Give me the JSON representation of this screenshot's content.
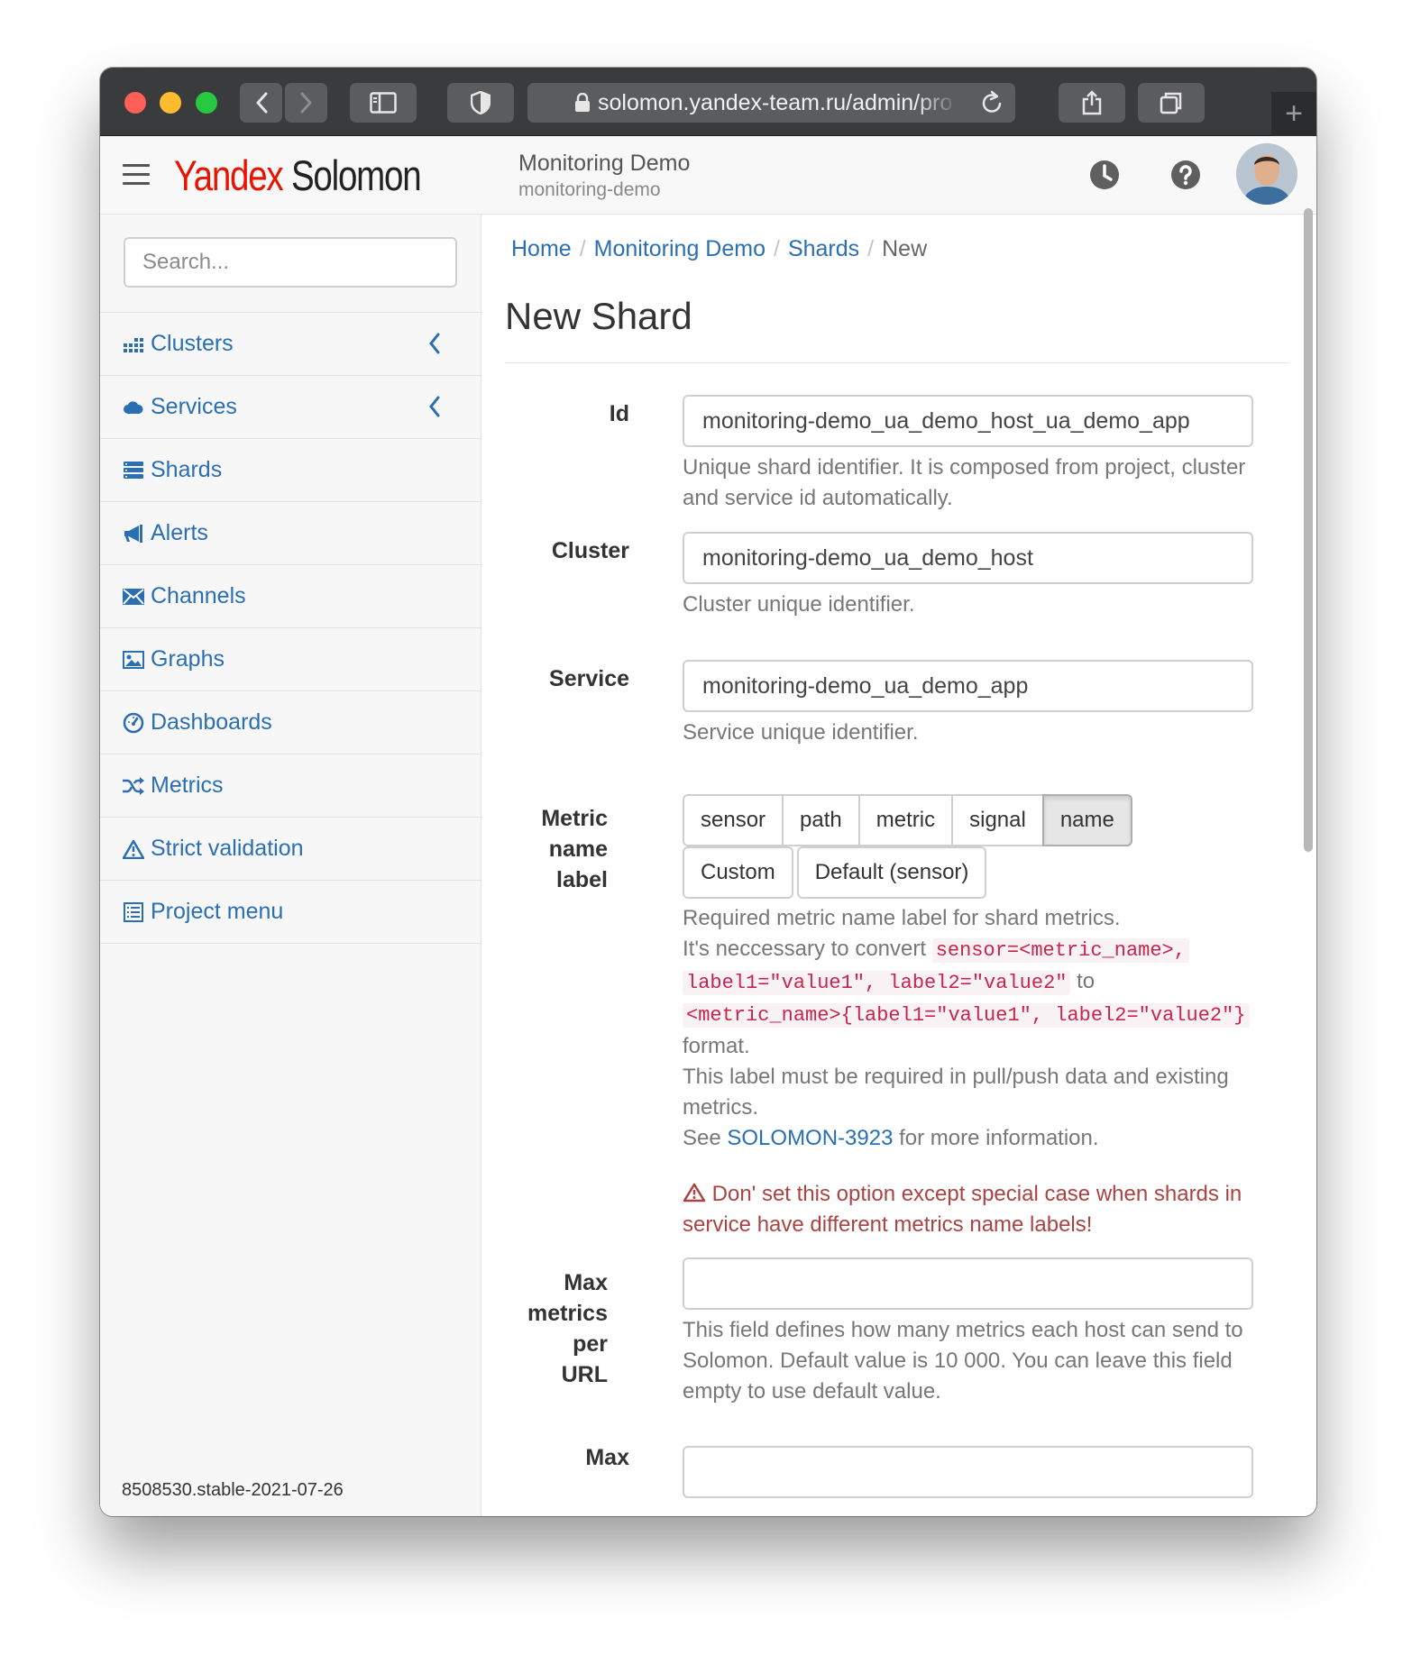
{
  "browser": {
    "url": "solomon.yandex-team.ru/admin/pro",
    "new_tab_symbol": "+"
  },
  "header": {
    "logo_yandex": "Yandex",
    "logo_solomon": "Solomon",
    "project_title": "Monitoring Demo",
    "project_id": "monitoring-demo"
  },
  "sidebar": {
    "search_placeholder": "Search...",
    "items": [
      {
        "label": "Clusters",
        "icon": "clusters-icon"
      },
      {
        "label": "Services",
        "icon": "cloud-icon"
      },
      {
        "label": "Shards",
        "icon": "shards-icon"
      },
      {
        "label": "Alerts",
        "icon": "megaphone-icon"
      },
      {
        "label": "Channels",
        "icon": "envelope-icon"
      },
      {
        "label": "Graphs",
        "icon": "picture-icon"
      },
      {
        "label": "Dashboards",
        "icon": "dashboard-icon"
      },
      {
        "label": "Metrics",
        "icon": "random-icon"
      },
      {
        "label": "Strict validation",
        "icon": "warning-icon"
      },
      {
        "label": "Project menu",
        "icon": "list-icon"
      }
    ],
    "version": "8508530.stable-2021-07-26"
  },
  "breadcrumb": {
    "home": "Home",
    "project": "Monitoring Demo",
    "shards": "Shards",
    "current": "New",
    "separator": "/"
  },
  "page_title": "New Shard",
  "form": {
    "id": {
      "label": "Id",
      "value": "monitoring-demo_ua_demo_host_ua_demo_app",
      "help": "Unique shard identifier. It is composed from project, cluster and service id automatically."
    },
    "cluster": {
      "label": "Cluster",
      "value": "monitoring-demo_ua_demo_host",
      "help": "Cluster unique identifier."
    },
    "service": {
      "label": "Service",
      "value": "monitoring-demo_ua_demo_app",
      "help": "Service unique identifier."
    },
    "metric_name_label": {
      "label_line1": "Metric",
      "label_line2": "name",
      "label_line3": "label",
      "options": [
        "sensor",
        "path",
        "metric",
        "signal",
        "name"
      ],
      "selected": "name",
      "extra_options": [
        "Custom",
        "Default (sensor)"
      ],
      "help_line1": "Required metric name label for shard metrics.",
      "help_convert_prefix": "It's neccessary to convert",
      "code1a": "sensor=<metric_name>,",
      "code1b": "label1=\"value1\", label2=\"value2\"",
      "help_to": "to",
      "code2": "<metric_name>{label1=\"value1\", label2=\"value2\"}",
      "help_format": "format.",
      "help_required": "This label must be required in pull/push data and existing metrics.",
      "help_see": "See",
      "help_link": "SOLOMON-3923",
      "help_more": "for more information.",
      "warning": "Don' set this option except special case when shards in service have different metrics name labels!"
    },
    "max_metrics": {
      "label_line1": "Max",
      "label_line2": "metrics",
      "label_line3": "per",
      "label_line4": "URL",
      "value": "",
      "help": "This field defines how many metrics each host can send to Solomon. Default value is 10 000. You can leave this field empty to use default value."
    },
    "next_field": {
      "label_line1": "Max"
    }
  }
}
